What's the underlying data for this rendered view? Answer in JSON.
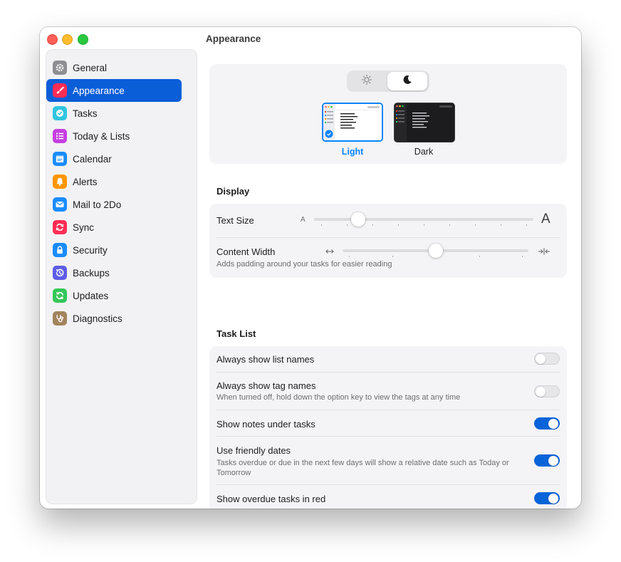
{
  "window": {
    "title": "Appearance"
  },
  "sidebar": {
    "items": [
      {
        "id": "general",
        "label": "General",
        "icon": "gear-icon",
        "color": "#8e8e93"
      },
      {
        "id": "appearance",
        "label": "Appearance",
        "icon": "paintbrush-icon",
        "color": "#ff2d55",
        "selected": true
      },
      {
        "id": "tasks",
        "label": "Tasks",
        "icon": "checkmark-circle-icon",
        "color": "#32c5e0"
      },
      {
        "id": "today-lists",
        "label": "Today & Lists",
        "icon": "list-icon",
        "color": "#c43fe0"
      },
      {
        "id": "calendar",
        "label": "Calendar",
        "icon": "calendar-icon",
        "color": "#1a8cff"
      },
      {
        "id": "alerts",
        "label": "Alerts",
        "icon": "bell-icon",
        "color": "#ff9500"
      },
      {
        "id": "mail-to-2do",
        "label": "Mail to 2Do",
        "icon": "envelope-icon",
        "color": "#1a8cff"
      },
      {
        "id": "sync",
        "label": "Sync",
        "icon": "sync-icon",
        "color": "#ff2d55"
      },
      {
        "id": "security",
        "label": "Security",
        "icon": "lock-icon",
        "color": "#1a8cff"
      },
      {
        "id": "backups",
        "label": "Backups",
        "icon": "clock-history-icon",
        "color": "#5e5ce6"
      },
      {
        "id": "updates",
        "label": "Updates",
        "icon": "refresh-icon",
        "color": "#34c759"
      },
      {
        "id": "diagnostics",
        "label": "Diagnostics",
        "icon": "stethoscope-icon",
        "color": "#a2845e"
      }
    ]
  },
  "theme": {
    "options": [
      {
        "label": "Light",
        "selected": true
      },
      {
        "label": "Dark",
        "selected": false
      }
    ],
    "accent": "#0a84ff"
  },
  "display": {
    "section_title": "Display",
    "text_size": {
      "label": "Text Size",
      "min_label": "A",
      "max_label": "A",
      "value": 0.2
    },
    "content_width": {
      "label": "Content Width",
      "description": "Adds padding around your tasks for easier reading",
      "value": 0.5
    }
  },
  "task_list": {
    "section_title": "Task List",
    "rows": [
      {
        "label": "Always show list names",
        "description": "",
        "on": false
      },
      {
        "label": "Always show tag names",
        "description": "When turned off, hold down the option key to view the tags at any time",
        "on": false
      },
      {
        "label": "Show notes under tasks",
        "description": "",
        "on": true
      },
      {
        "label": "Use friendly dates",
        "description": "Tasks overdue or due in the next few days will show a relative date such as Today or Tomorrow",
        "on": true
      },
      {
        "label": "Show overdue tasks in red",
        "description": "",
        "on": true
      }
    ]
  }
}
